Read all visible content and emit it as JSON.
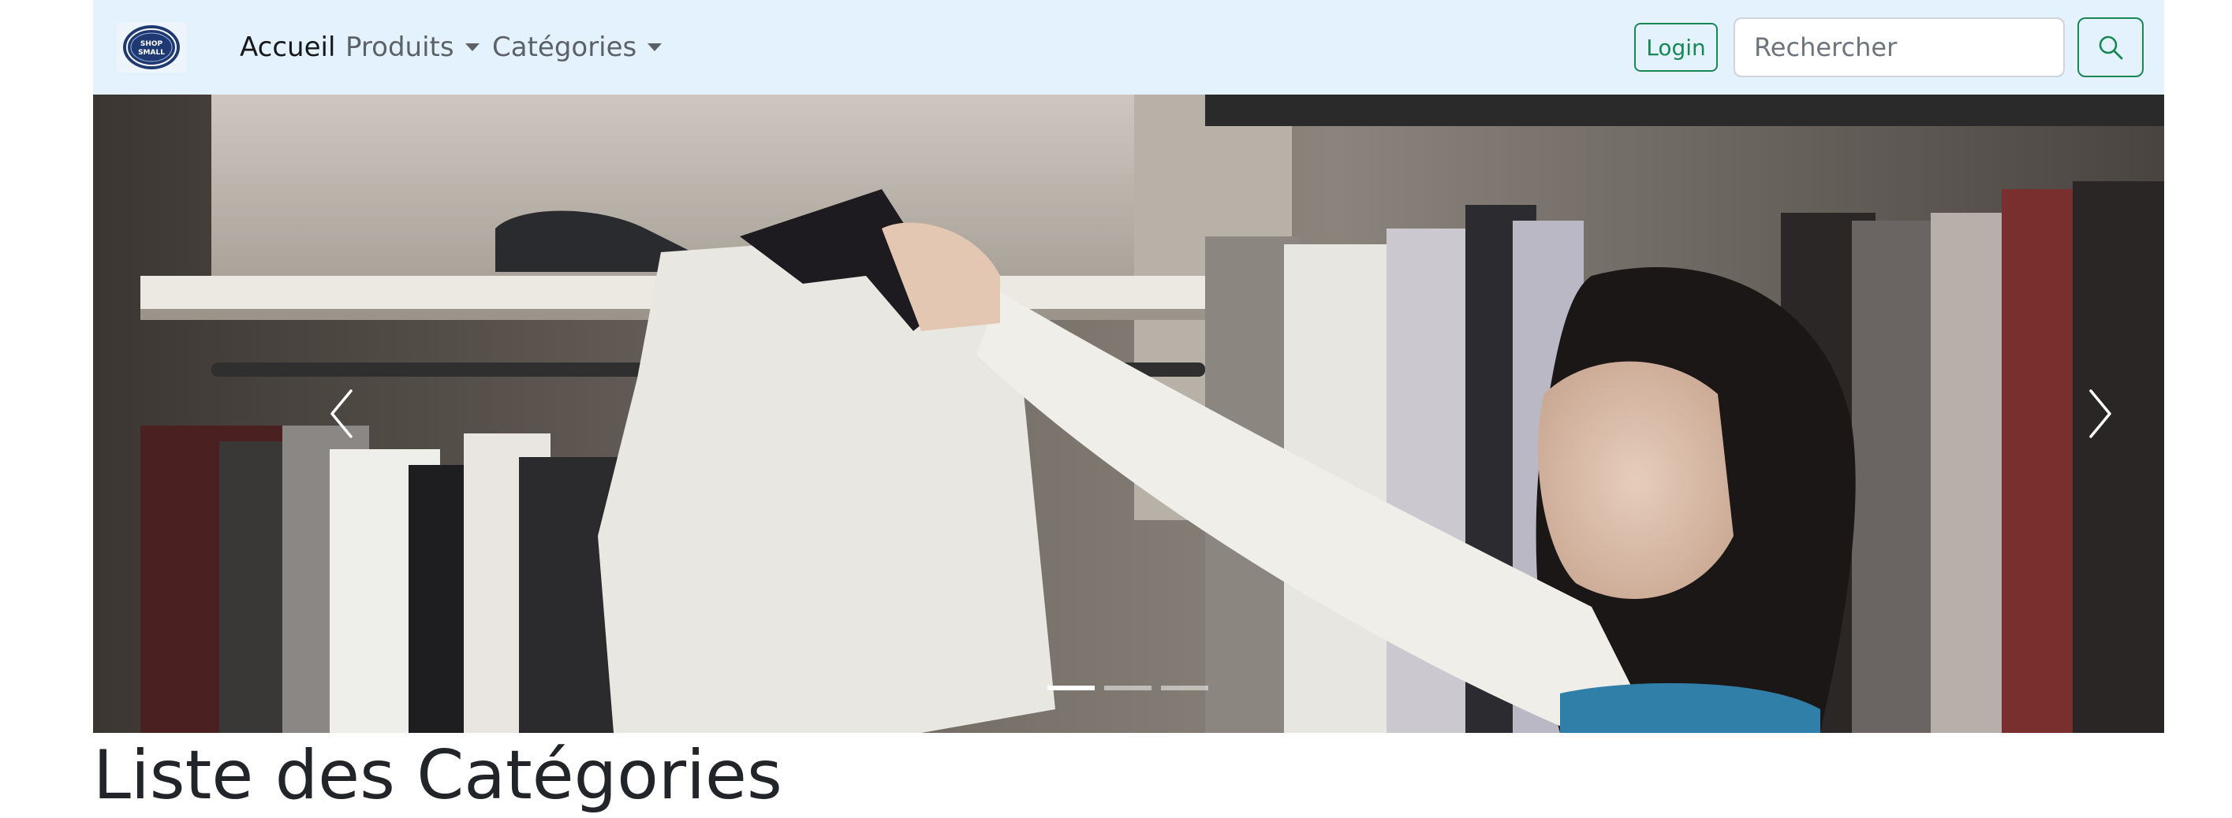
{
  "navbar": {
    "brand_logo_text": [
      "SHOP",
      "SMALL"
    ],
    "links": [
      {
        "label": "Accueil"
      },
      {
        "label": "Produits"
      },
      {
        "label": "Catégories"
      }
    ],
    "login_label": "Login",
    "search_placeholder": "Rechercher",
    "colors": {
      "background": "#e3f2fd",
      "accent": "#198754"
    }
  },
  "carousel": {
    "slides_count": 3,
    "active_slide": 1,
    "prev_icon": "chevron-left-icon",
    "next_icon": "chevron-right-icon"
  },
  "main": {
    "title": "Liste des Catégories"
  }
}
